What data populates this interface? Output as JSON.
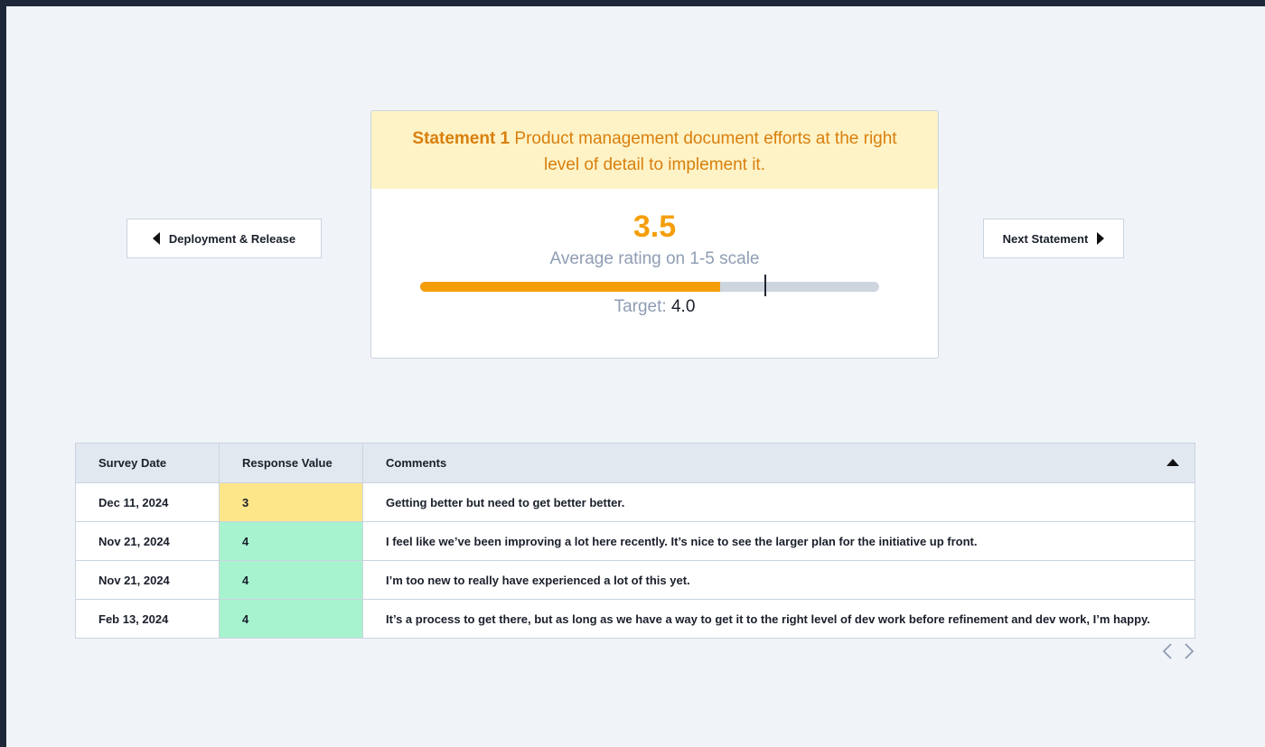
{
  "nav": {
    "prev_label": "Deployment & Release",
    "next_label": "Next Statement"
  },
  "statement": {
    "number_label": "Statement 1",
    "text": "Product management document efforts at the right level of detail to implement it.",
    "score": "3.5",
    "score_caption": "Average rating on 1-5 scale",
    "target_label": "Target:",
    "target_value": "4.0",
    "progress_fraction": 0.654,
    "target_fraction": 0.75
  },
  "table": {
    "columns": [
      "Survey Date",
      "Response Value",
      "Comments"
    ],
    "rows": [
      {
        "date": "Dec 11, 2024",
        "value": "3",
        "comment": "Getting better but need to get better better.",
        "color": "#fde68a"
      },
      {
        "date": "Nov 21, 2024",
        "value": "4",
        "comment": "I feel like we’ve been improving a lot here recently. It’s nice to see the larger plan for the initiative up front.",
        "color": "#a7f3d0"
      },
      {
        "date": "Nov 21, 2024",
        "value": "4",
        "comment": "I’m too new to really have experienced a lot of this yet.",
        "color": "#a7f3d0"
      },
      {
        "date": "Feb 13, 2024",
        "value": "4",
        "comment": "It’s a process to get there, but as long as we have a way to get it to the right level of dev work before refinement and dev work, I’m happy.",
        "color": "#a7f3d0"
      }
    ]
  },
  "colors": {
    "accent": "#f59e0b",
    "header_bg": "#fef3c7",
    "track": "#cdd5df"
  }
}
